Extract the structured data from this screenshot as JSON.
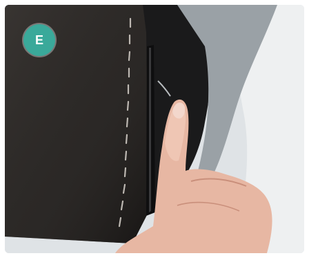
{
  "step": {
    "label": "E",
    "badge_color": "#3aa99a"
  },
  "photo": {
    "subject_colors": {
      "cushion": "#2b2826",
      "background": "#d9dee2",
      "skin": "#e7b7a3"
    }
  }
}
